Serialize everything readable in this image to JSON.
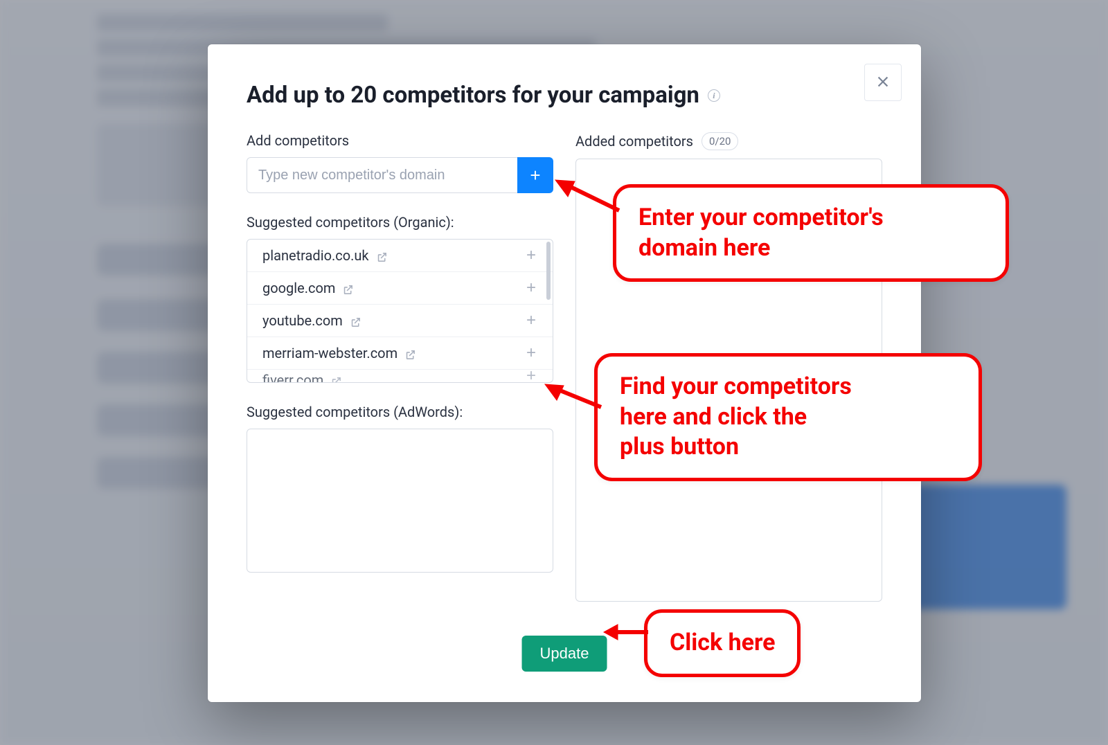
{
  "modal": {
    "title": "Add up to 20 competitors for your campaign",
    "add_label": "Add competitors",
    "input_placeholder": "Type new competitor's domain",
    "suggested_organic_label": "Suggested competitors (Organic):",
    "suggested_adwords_label": "Suggested competitors (AdWords):",
    "added_label": "Added competitors",
    "added_count": "0/20",
    "update_label": "Update",
    "suggested_organic": [
      "planetradio.co.uk",
      "google.com",
      "youtube.com",
      "merriam-webster.com",
      "fiverr.com"
    ]
  },
  "callouts": {
    "c1": "Enter your competitor's\ndomain here",
    "c2": "Find your competitors\nhere and click the\nplus button",
    "c3": "Click here"
  }
}
